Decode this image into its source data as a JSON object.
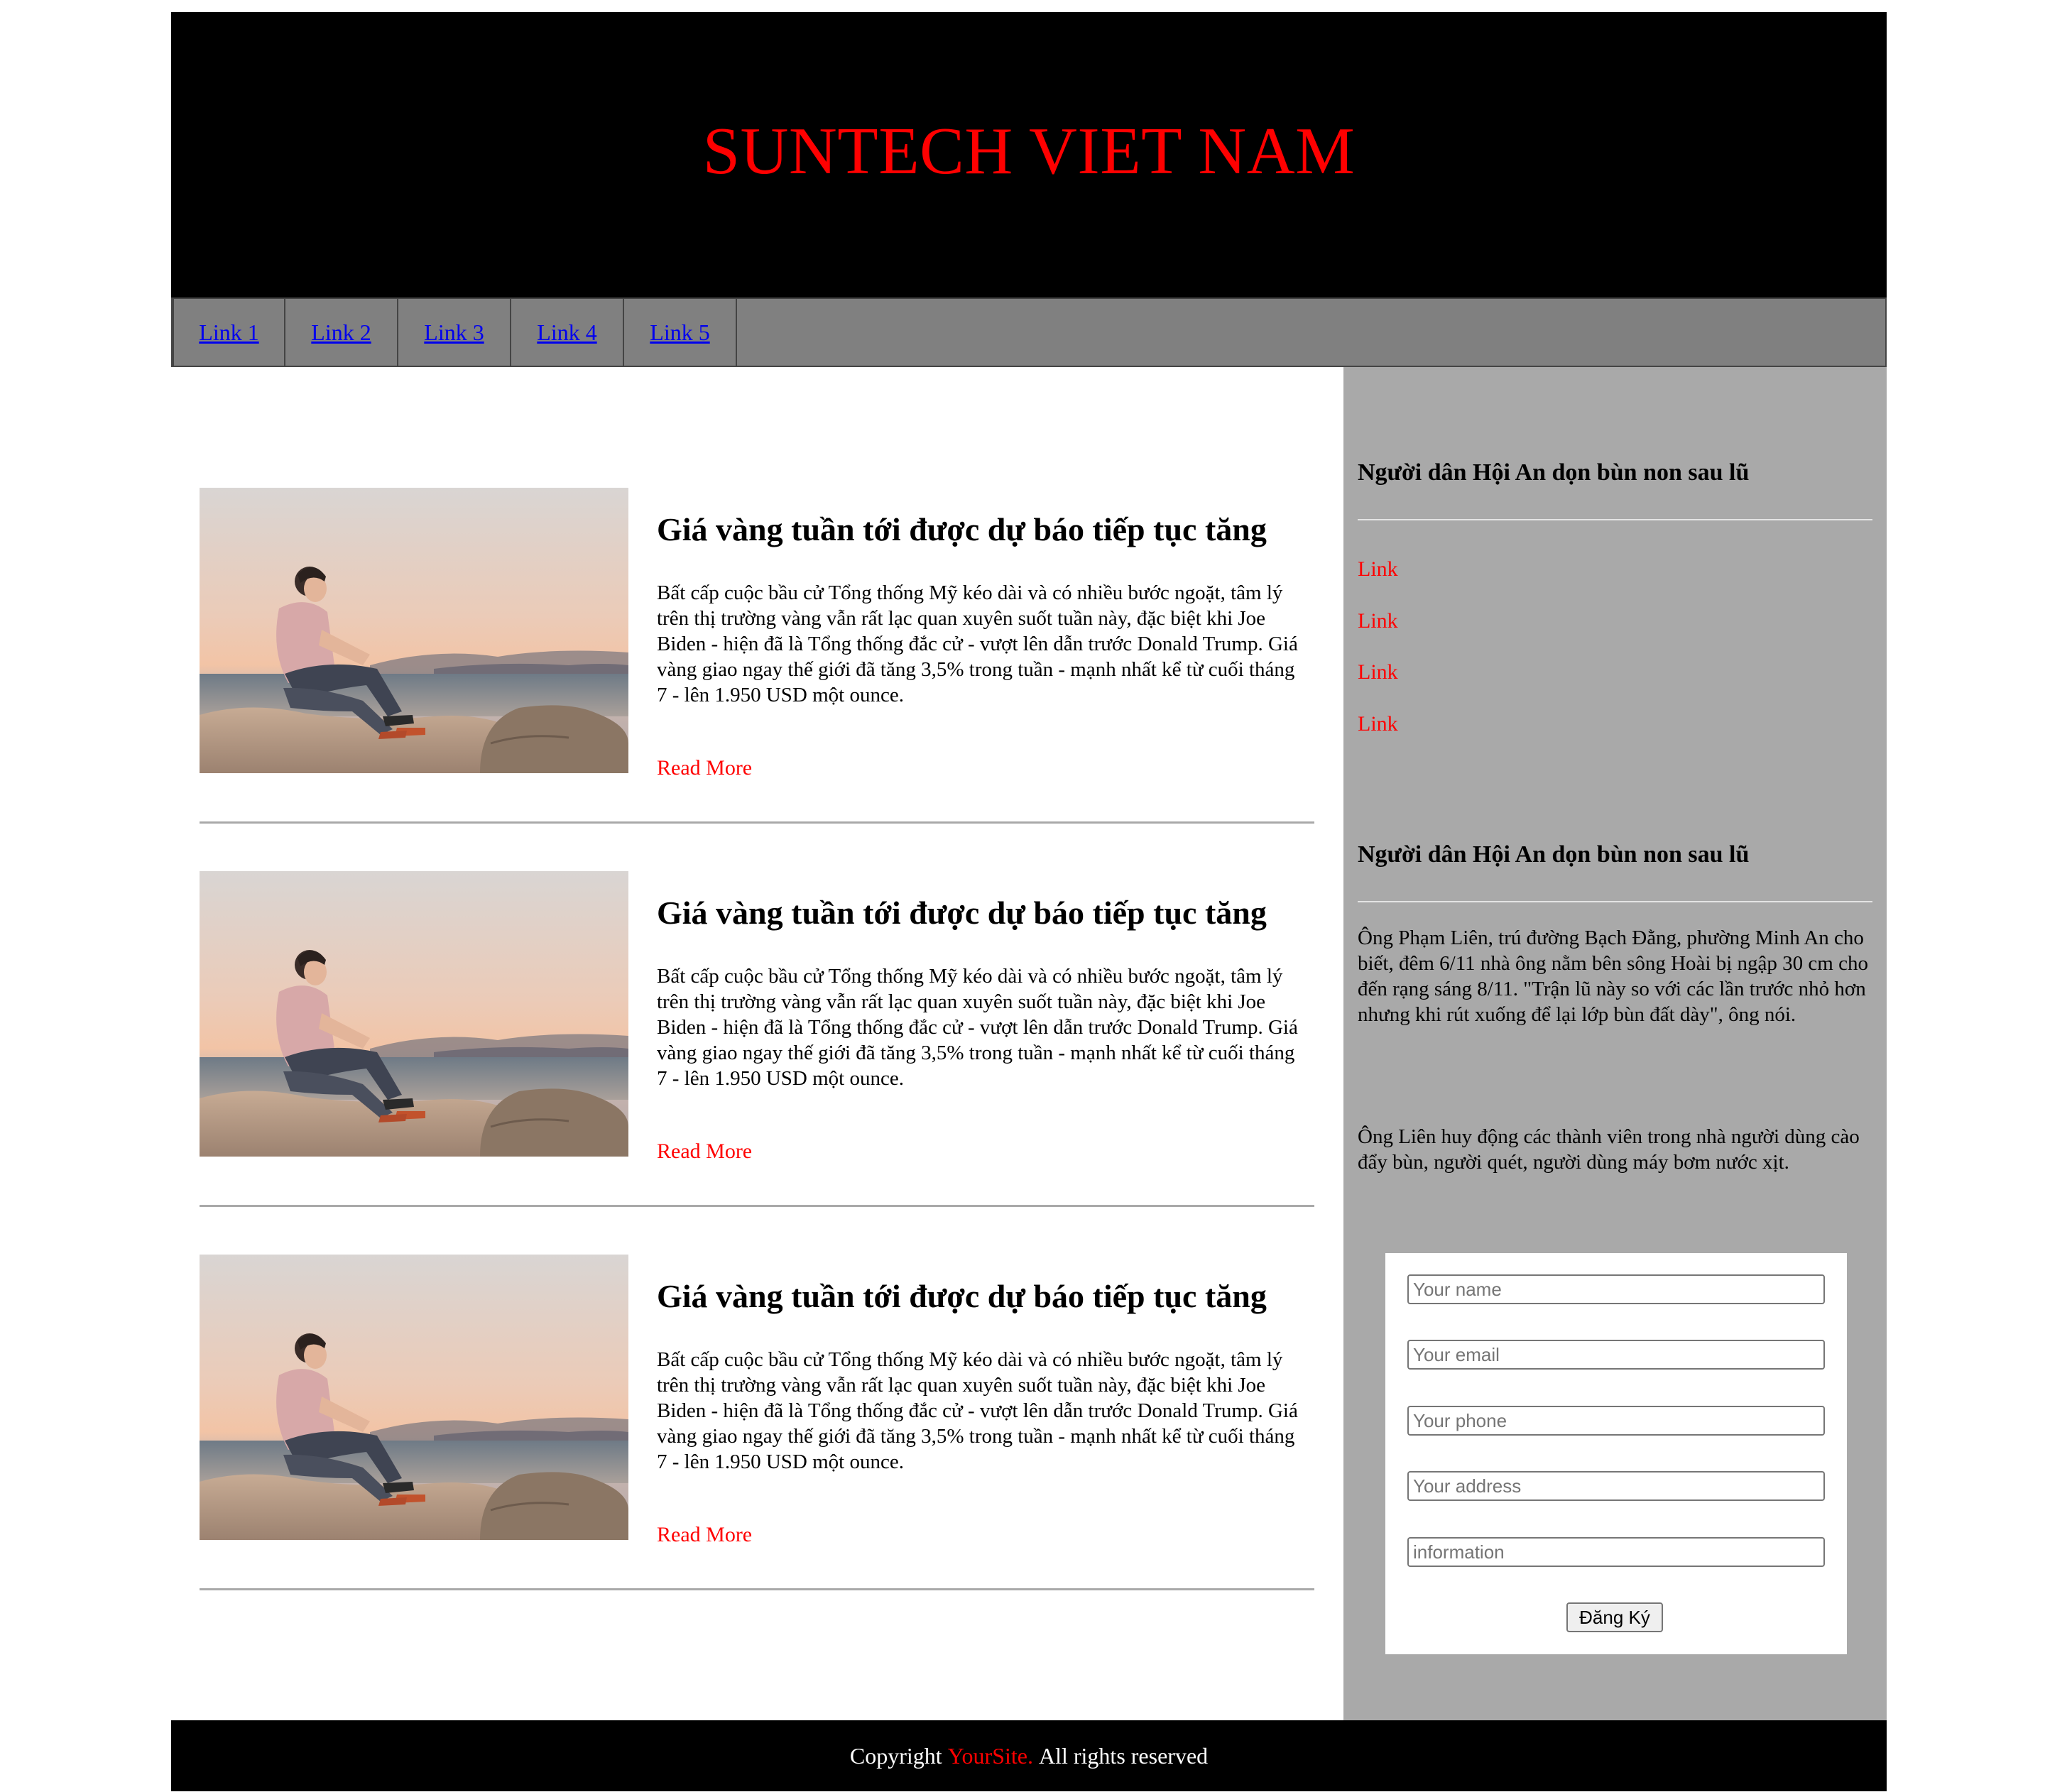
{
  "header": {
    "title": "SUNTECH VIET NAM"
  },
  "nav": {
    "items": [
      "Link 1",
      "Link 2",
      "Link 3",
      "Link 4",
      "Link 5"
    ]
  },
  "articles": [
    {
      "title": "Giá vàng tuần tới được dự báo tiếp tục tăng",
      "excerpt": "Bất cấp cuộc bầu cử Tổng thống Mỹ kéo dài và có nhiều bước ngoặt, tâm lý trên thị trường vàng vẫn rất lạc quan xuyên suốt tuần này, đặc biệt khi Joe Biden - hiện đã là Tổng thống đắc cử - vượt lên dẫn trước Donald Trump. Giá vàng giao ngay thế giới đã tăng 3,5% trong tuần - mạnh nhất kể từ cuối tháng 7 - lên 1.950 USD một ounce.",
      "read_more": "Read More"
    },
    {
      "title": "Giá vàng tuần tới được dự báo tiếp tục tăng",
      "excerpt": "Bất cấp cuộc bầu cử Tổng thống Mỹ kéo dài và có nhiều bước ngoặt, tâm lý trên thị trường vàng vẫn rất lạc quan xuyên suốt tuần này, đặc biệt khi Joe Biden - hiện đã là Tổng thống đắc cử - vượt lên dẫn trước Donald Trump. Giá vàng giao ngay thế giới đã tăng 3,5% trong tuần - mạnh nhất kể từ cuối tháng 7 - lên 1.950 USD một ounce.",
      "read_more": "Read More"
    },
    {
      "title": "Giá vàng tuần tới được dự báo tiếp tục tăng",
      "excerpt": "Bất cấp cuộc bầu cử Tổng thống Mỹ kéo dài và có nhiều bước ngoặt, tâm lý trên thị trường vàng vẫn rất lạc quan xuyên suốt tuần này, đặc biệt khi Joe Biden - hiện đã là Tổng thống đắc cử - vượt lên dẫn trước Donald Trump. Giá vàng giao ngay thế giới đã tăng 3,5% trong tuần - mạnh nhất kể từ cuối tháng 7 - lên 1.950 USD một ounce.",
      "read_more": "Read More"
    }
  ],
  "sidebar": {
    "links_widget": {
      "heading": "Người dân Hội An dọn bùn non sau lũ",
      "links": [
        "Link",
        "Link",
        "Link",
        "Link"
      ]
    },
    "text_widget": {
      "heading": "Người dân Hội An dọn bùn non sau lũ",
      "paragraphs": [
        "Ông Phạm Liên, trú đường Bạch Đằng, phường Minh An cho biết, đêm 6/11 nhà ông nằm bên sông Hoài bị ngập 30 cm cho đến rạng sáng 8/11. \"Trận lũ này so với các lần trước nhỏ hơn nhưng khi rút xuống để lại lớp bùn đất dày\", ông nói.",
        "Ông Liên huy động các thành viên trong nhà người dùng cào đẩy bùn, người quét, người dùng máy bơm nước xịt."
      ]
    },
    "form": {
      "name_placeholder": "Your name",
      "email_placeholder": "Your email",
      "phone_placeholder": "Your phone",
      "address_placeholder": "Your address",
      "info_placeholder": "information",
      "submit_label": "Đăng Ký"
    }
  },
  "footer": {
    "prefix": "Copyright",
    "brand": "YourSite.",
    "suffix": "All rights reserved"
  },
  "colors": {
    "header_bg": "#000000",
    "accent": "#ff0000",
    "nav_bg": "#808080",
    "nav_link": "#0000ee",
    "sidebar_bg": "#a9a9a9",
    "footer_bg": "#000000"
  },
  "images": {
    "article_photo": "person-sitting-on-rocks-by-sea-at-sunset"
  }
}
